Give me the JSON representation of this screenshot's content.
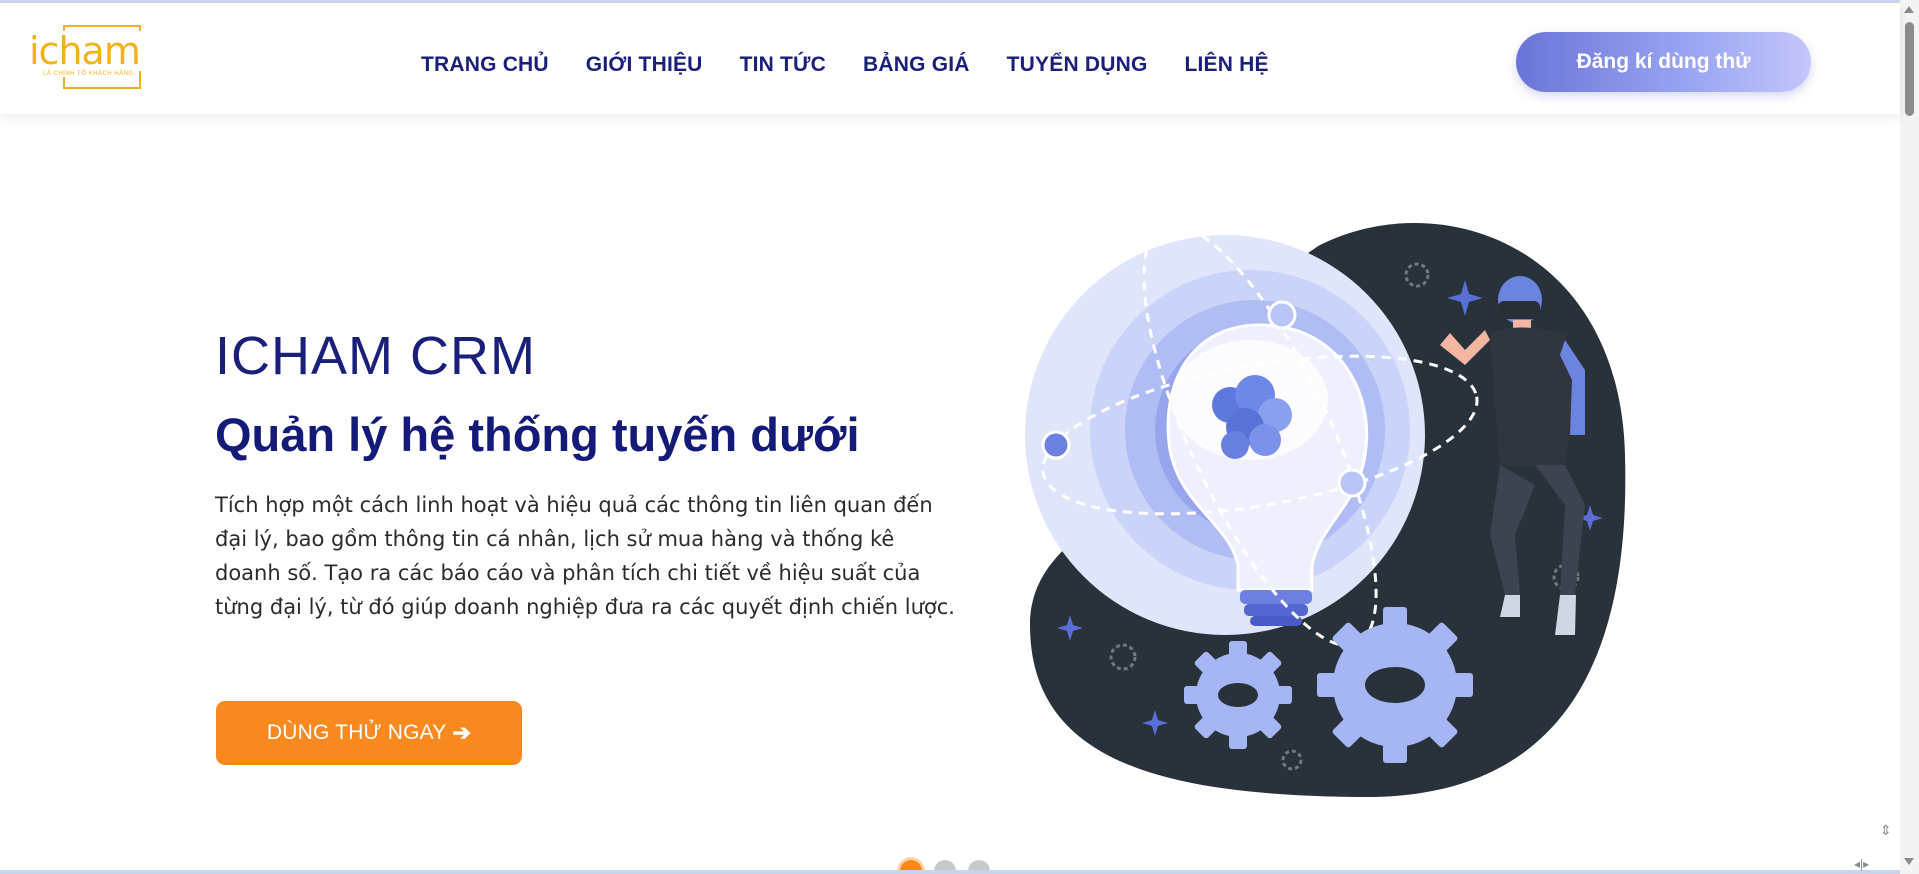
{
  "brand": {
    "logo_text": "icham",
    "logo_tagline": "LÀ CHÍNH TỐ KHÁCH HÀNG",
    "accent_color": "#f3b21c",
    "primary_color": "#141a78",
    "cta_color": "#f7891f"
  },
  "nav": {
    "items": [
      {
        "label": "TRANG CHỦ"
      },
      {
        "label": "GIỚI THIỆU"
      },
      {
        "label": "TIN TỨC"
      },
      {
        "label": "BẢNG GIÁ"
      },
      {
        "label": "TUYỂN DỤNG"
      },
      {
        "label": "LIÊN HỆ"
      }
    ],
    "trial_button": "Đăng kí dùng thử"
  },
  "hero": {
    "kicker": "ICHAM CRM",
    "title": "Quản lý hệ thống tuyến dưới",
    "description": "Tích hợp một cách linh hoạt và hiệu quả các thông tin liên quan đến đại lý, bao gồm thông tin cá nhân, lịch sử mua hàng và thống kê doanh số. Tạo ra các báo cáo và phân tích chi tiết về hiệu suất của từng đại lý, từ đó giúp doanh nghiệp đưa ra các quyết định chiến lược.",
    "button_label": "DÙNG THỬ NGAY",
    "button_icon": "arrow-right-icon",
    "illustration": "lightbulb-vr-person-gears-illustration"
  },
  "slider": {
    "count": 3,
    "active_index": 0
  },
  "icons": [
    "arrow-right-icon",
    "gear-icon",
    "sparkle-icon"
  ]
}
